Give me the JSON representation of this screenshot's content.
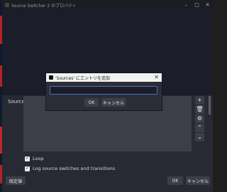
{
  "window": {
    "title": "Source Switcher 2 のプロパティ",
    "controls": [
      "–",
      "□",
      "✕"
    ]
  },
  "sources": {
    "label": "Sources",
    "side_buttons": [
      "+",
      "🗑",
      "⚙",
      "⌃",
      "⌄"
    ]
  },
  "options": {
    "loop_label": "Loop",
    "loop_checked": true,
    "log_label": "Log source switches and transitions",
    "log_checked": true
  },
  "footer": {
    "defaults_label": "既定値",
    "ok_label": "OK",
    "cancel_label": "キャンセル"
  },
  "dialog": {
    "title": "'Sources' にエントリを追加",
    "close": "✕",
    "input_value": "",
    "ok_label": "OK",
    "cancel_label": "キャンセル"
  },
  "icons": {
    "add": "plus-icon",
    "remove": "trash-icon",
    "settings": "gear-icon",
    "up": "chevron-up-icon",
    "down": "chevron-down-icon"
  },
  "colors": {
    "accent": "#4a6bd0"
  }
}
